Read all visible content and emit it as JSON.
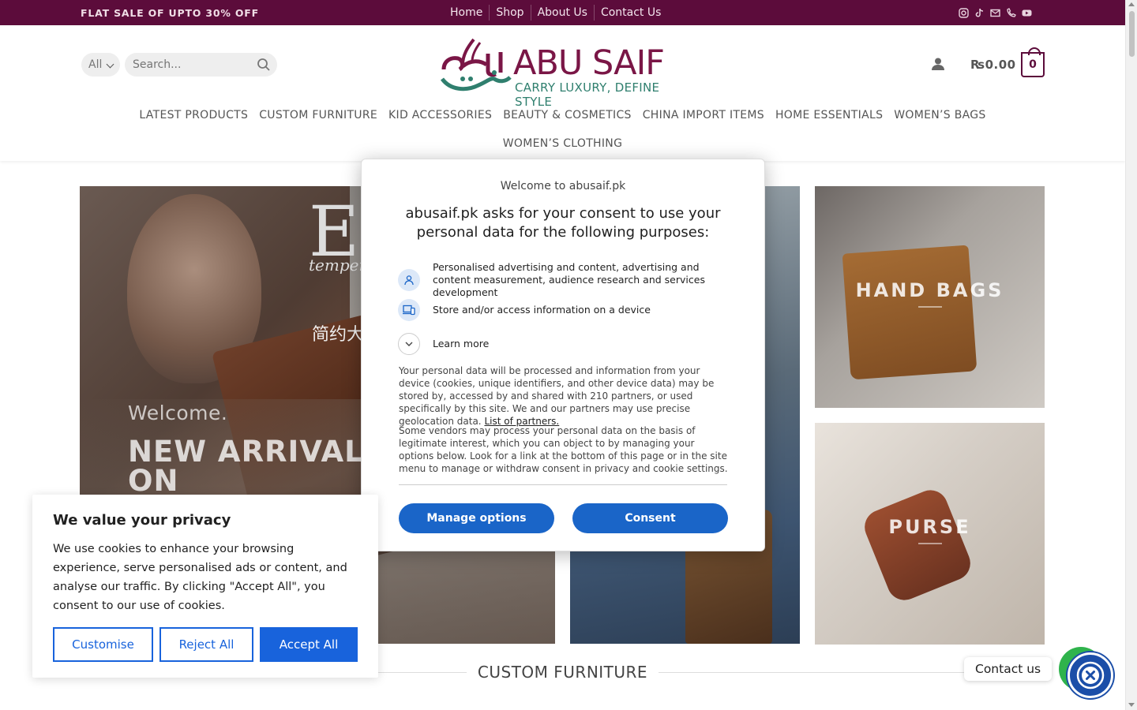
{
  "topbar": {
    "promo": "FLAT SALE OF UPTO 30% OFF",
    "nav": [
      "Home",
      "Shop",
      "About Us",
      "Contact Us"
    ],
    "social_icons": [
      "instagram-icon",
      "tiktok-icon",
      "mail-icon",
      "phone-icon",
      "youtube-icon"
    ],
    "color": "#5c0c3b"
  },
  "header": {
    "category_select": "All",
    "search_placeholder": "Search...",
    "logo_brand": "ABU SAIF",
    "logo_arabic": "أبو سيف",
    "logo_tagline": "CARRY LUXURY, DEFINE STYLE",
    "cart_total": "₨0.00",
    "cart_count": "0",
    "nav_row1": [
      "LATEST PRODUCTS",
      "CUSTOM FURNITURE",
      "KID ACCESSORIES",
      "BEAUTY & COSMETICS",
      "CHINA IMPORT ITEMS",
      "HOME ESSENTIALS",
      "WOMEN’S BAGS"
    ],
    "nav_row2": [
      "WOMEN’S CLOTHING"
    ]
  },
  "hero": {
    "main_welcome": "Welcome.",
    "main_headline": "NEW ARRIVALS ON",
    "main_image_text_big": "E",
    "main_image_text_small": "temper",
    "main_image_chinese": "简约大",
    "tile_handbags": "HAND BAGS",
    "tile_purse": "PURSE"
  },
  "section": {
    "title": "CUSTOM FURNITURE"
  },
  "consent_modal": {
    "welcome": "Welcome to abusaif.pk",
    "heading": "abusaif.pk asks for your consent to use your personal data for the following purposes:",
    "purpose1": "Personalised advertising and content, advertising and content measurement, audience research and services development",
    "purpose2": "Store and/or access information on a device",
    "learn_more": "Learn more",
    "para1": "Your personal data will be processed and information from your device (cookies, unique identifiers, and other device data) may be stored by, accessed by and shared with 210 partners, or used specifically by this site. We and our partners may use precise geolocation data.",
    "partners_link": "List of partners.",
    "para2": "Some vendors may process your personal data on the basis of legitimate interest, which you can object to by managing your options below. Look for a link at the bottom of this page or in the site menu to manage or withdraw consent in privacy and cookie settings.",
    "manage_button": "Manage options",
    "consent_button": "Consent",
    "accent": "#1a65c8"
  },
  "cookie_banner": {
    "title": "We value your privacy",
    "text": "We use cookies to enhance your browsing experience, serve personalised ads or content, and analyse our traffic. By clicking \"Accept All\", you consent to our use of cookies.",
    "customise": "Customise",
    "reject": "Reject All",
    "accept": "Accept All",
    "accent": "#1863dc"
  },
  "widgets": {
    "contact_label": "Contact us"
  }
}
